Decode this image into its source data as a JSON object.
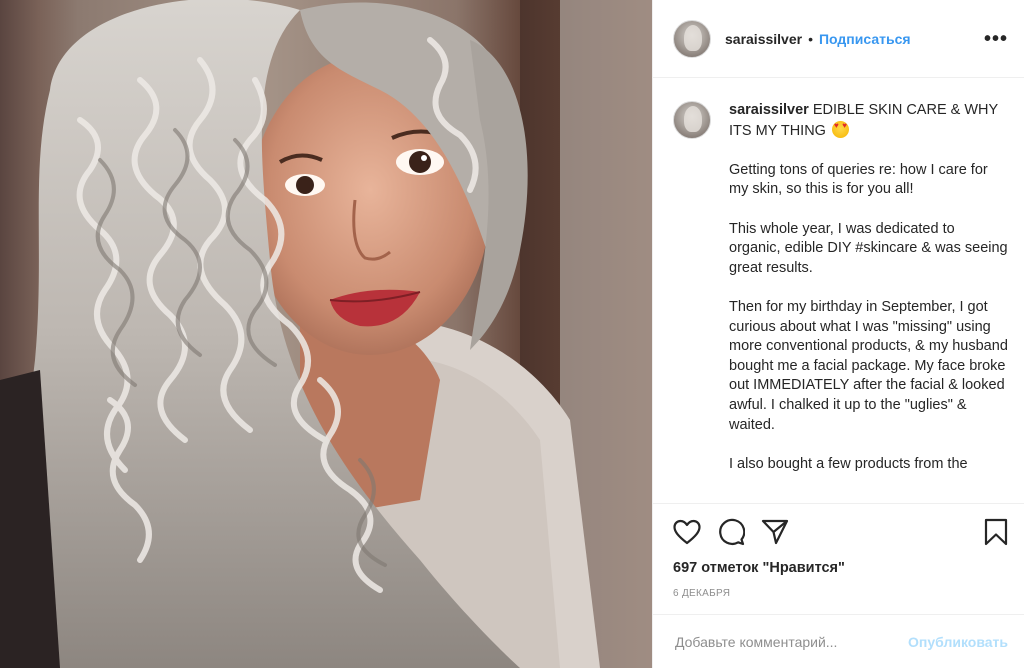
{
  "post": {
    "username": "saraissilver",
    "follow_label": "Подписаться",
    "header_separator": "•",
    "more_label": "•••",
    "caption": {
      "username": "saraissilver",
      "title": "EDIBLE SKIN CARE & WHY ITS MY THING",
      "title_emoji": "star-struck-emoji",
      "paragraphs": [
        "Getting tons of queries re: how I care for my skin, so this is for you all!",
        "This whole year, I was dedicated to organic, edible DIY #skincare & was seeing great results.",
        "Then for my birthday in September, I got curious about what I was \"missing\" using more conventional products, & my husband bought me a facial package. My face broke out IMMEDIATELY after the facial & looked awful. I chalked it up to the \"uglies\" & waited.",
        "I also bought a few products from the"
      ]
    },
    "actions": {
      "icons": [
        "heart-icon",
        "comment-icon",
        "share-icon",
        "bookmark-icon"
      ],
      "likes": "697 отметок \"Нравится\"",
      "date": "6 ДЕКАБРЯ"
    },
    "comment": {
      "placeholder": "Добавьте комментарий...",
      "publish_label": "Опубликовать"
    },
    "colors": {
      "link": "#3897f0",
      "publish_disabled": "#b2dffc",
      "muted": "#8e8e8e",
      "border": "#efefef"
    }
  }
}
